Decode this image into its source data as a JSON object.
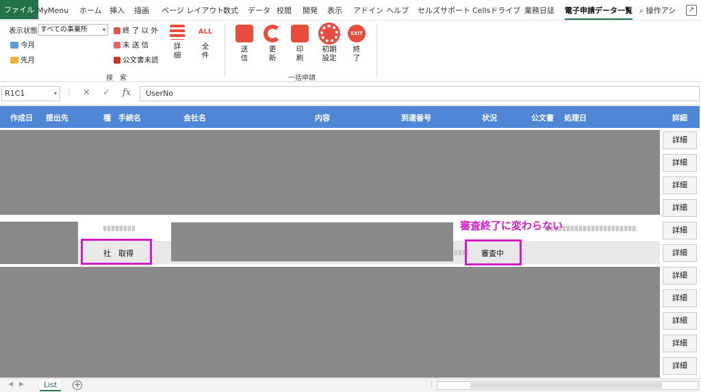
{
  "tabs": [
    "ファイル",
    "MyMenu",
    "ホーム",
    "挿入",
    "描画",
    "ページ レイアウト",
    "数式",
    "データ",
    "校閲",
    "開発",
    "表示",
    "アドイン",
    "ヘルプ",
    "セルズサポート",
    "Cellsドライブ",
    "業務日誌",
    "電子申請データ一覧",
    "操作アシ"
  ],
  "ribbon": {
    "display_state_label": "表示状態",
    "display_state_value": "すべての事業所",
    "this_month": "今月",
    "last_month": "先月",
    "non_finished": "終 了 以 外",
    "unsent": "未 送 信",
    "unread_doc": "公文書未読",
    "detail_btn": "詳\n細",
    "all_btn": "全\n件",
    "search_group": "検　索",
    "send_btn": "送\n信",
    "update_btn": "更\n新",
    "print_btn": "印\n刷",
    "init_btn": "初期\n設定",
    "exit_btn": "終\n了",
    "batch_group": "一括申請",
    "all_icon_text": "ALL",
    "exit_icon_text": "EXIT"
  },
  "formula_bar": {
    "name_box": "R1C1",
    "cancel": "✕",
    "enter": "✓",
    "fx": "fx",
    "content": "UserNo"
  },
  "table": {
    "headers": {
      "created": "作成日",
      "submit_to": "提出先",
      "kind": "種",
      "procedure": "手続名",
      "company": "会社名",
      "content": "内容",
      "arrival_no": "到達番号",
      "status": "状況",
      "official_doc": "公文書",
      "processed": "処理日",
      "detail": "詳細"
    },
    "detail_label": "詳細",
    "visible_procedure": "社　取得",
    "visible_status": "審査中"
  },
  "annotation": "審査終了に変わらない",
  "sheet": {
    "tab": "List",
    "add": "+"
  },
  "colors": {
    "excel_green": "#217346",
    "header_blue": "#4f86d6",
    "highlight_magenta": "#d21bc8",
    "redaction_gray": "#8a8a8a"
  }
}
